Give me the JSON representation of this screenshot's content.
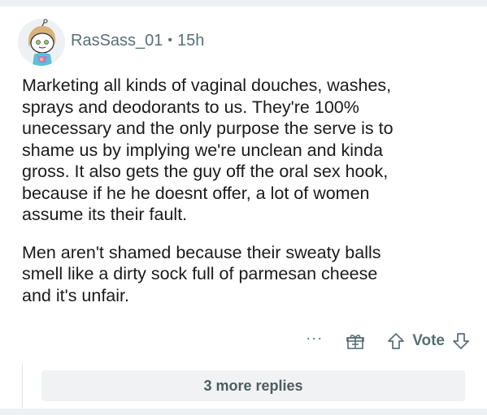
{
  "comment": {
    "author": "RasSass_01",
    "separator": "•",
    "age": "15h",
    "paragraphs": [
      "Marketing all kinds of vaginal douches, washes,\nsprays and deodorants to us. They're 100%\nunecessary and the only purpose the serve is to\nshame us by implying we're unclean and kinda\ngross. It also gets the guy off the oral sex hook,\nbecause if he he doesnt offer, a lot of women\nassume its their fault.",
      "Men aren't shamed because their sweaty balls\nsmell like a dirty sock full of parmesan cheese\nand it's unfair."
    ]
  },
  "actions": {
    "more_label": "···",
    "vote_label": "Vote"
  },
  "replies": {
    "more_label": "3 more replies"
  },
  "colors": {
    "meta_text": "#576f76",
    "body_text": "#1a1a1b",
    "reply_bg": "#f0f2f4"
  },
  "icons": {
    "avatar": "avatar-snoo",
    "award": "gift-icon",
    "upvote": "upvote-arrow-icon",
    "downvote": "downvote-arrow-icon"
  }
}
